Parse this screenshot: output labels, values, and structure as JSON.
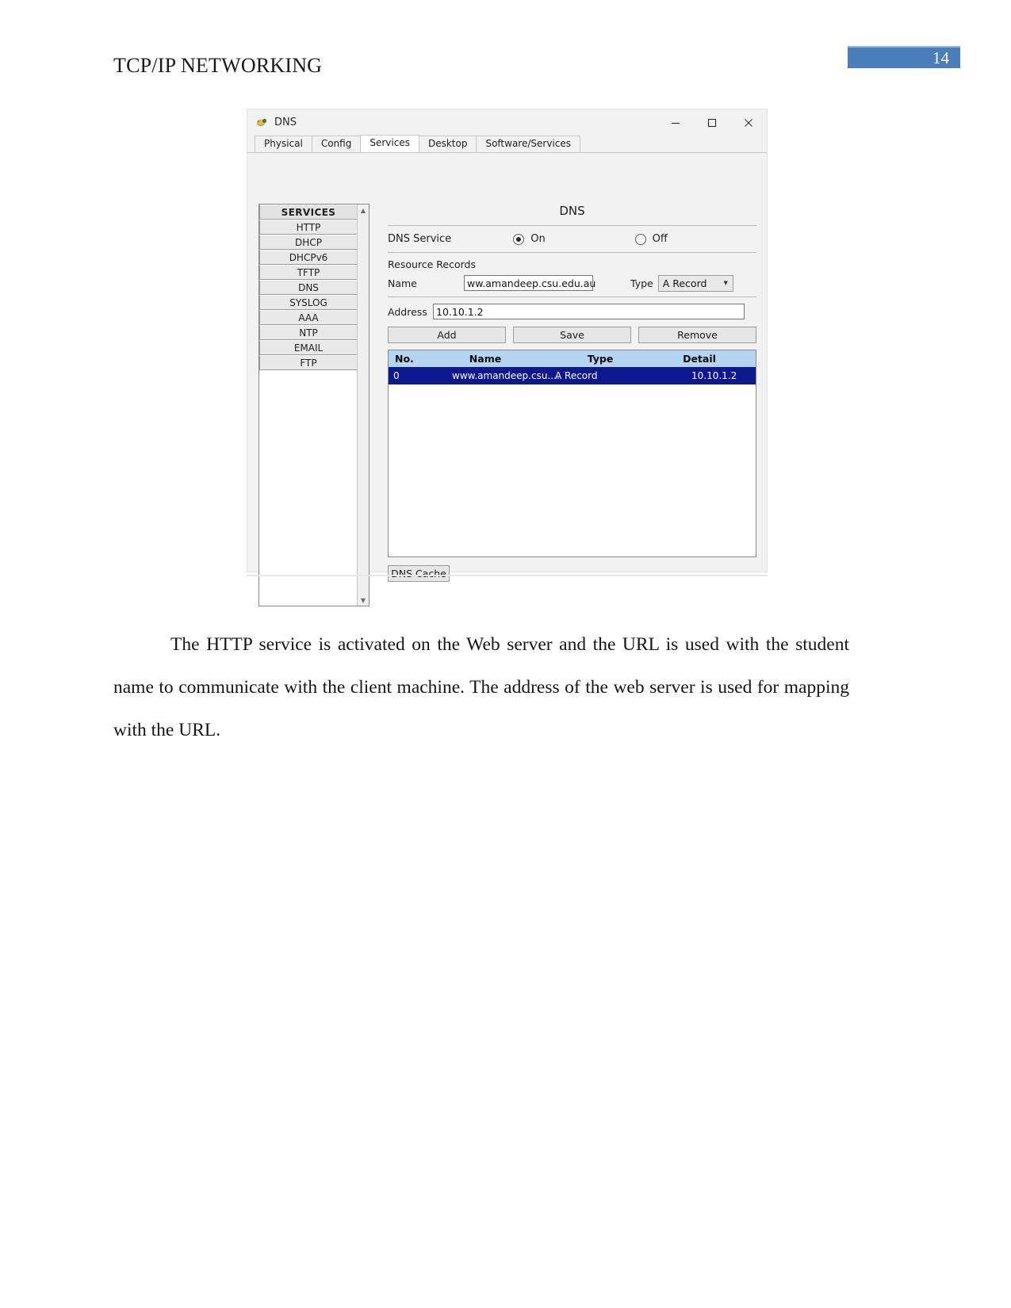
{
  "document": {
    "header_title": "TCP/IP NETWORKING",
    "page_number": "14",
    "accent_color": "#4a7ebb",
    "paragraph": "The HTTP service is activated on the Web server and the URL is used with the student name to communicate with the client machine. The address of the web server is used for mapping with the URL."
  },
  "app_window": {
    "title": "DNS",
    "icon": "packet-tracer-device-icon",
    "controls": {
      "minimize": "minimize-icon",
      "maximize": "maximize-icon",
      "close": "close-icon"
    },
    "tabs": [
      {
        "label": "Physical",
        "active": false
      },
      {
        "label": "Config",
        "active": false
      },
      {
        "label": "Services",
        "active": true
      },
      {
        "label": "Desktop",
        "active": false
      },
      {
        "label": "Software/Services",
        "active": false
      }
    ],
    "sidebar": {
      "header": "SERVICES",
      "items": [
        {
          "label": "HTTP"
        },
        {
          "label": "DHCP"
        },
        {
          "label": "DHCPv6"
        },
        {
          "label": "TFTP"
        },
        {
          "label": "DNS"
        },
        {
          "label": "SYSLOG"
        },
        {
          "label": "AAA"
        },
        {
          "label": "NTP"
        },
        {
          "label": "EMAIL"
        },
        {
          "label": "FTP"
        }
      ]
    },
    "pane": {
      "title": "DNS",
      "service_label": "DNS Service",
      "radio_on": "On",
      "radio_off": "Off",
      "service_state": "On",
      "resource_records_label": "Resource Records",
      "name_label": "Name",
      "name_value": "ww.amandeep.csu.edu.au",
      "type_label": "Type",
      "type_value": "A Record",
      "address_label": "Address",
      "address_value": "10.10.1.2",
      "buttons": {
        "add": "Add",
        "save": "Save",
        "remove": "Remove",
        "dns_cache": "DNS Cache"
      },
      "table": {
        "columns": [
          "No.",
          "Name",
          "Type",
          "Detail"
        ],
        "rows": [
          {
            "no": "0",
            "name": "www.amandeep.csu....",
            "type": "A Record",
            "detail": "10.10.1.2"
          }
        ],
        "selected_row_color": "#0d178f",
        "header_color": "#b5d5ee"
      }
    }
  }
}
